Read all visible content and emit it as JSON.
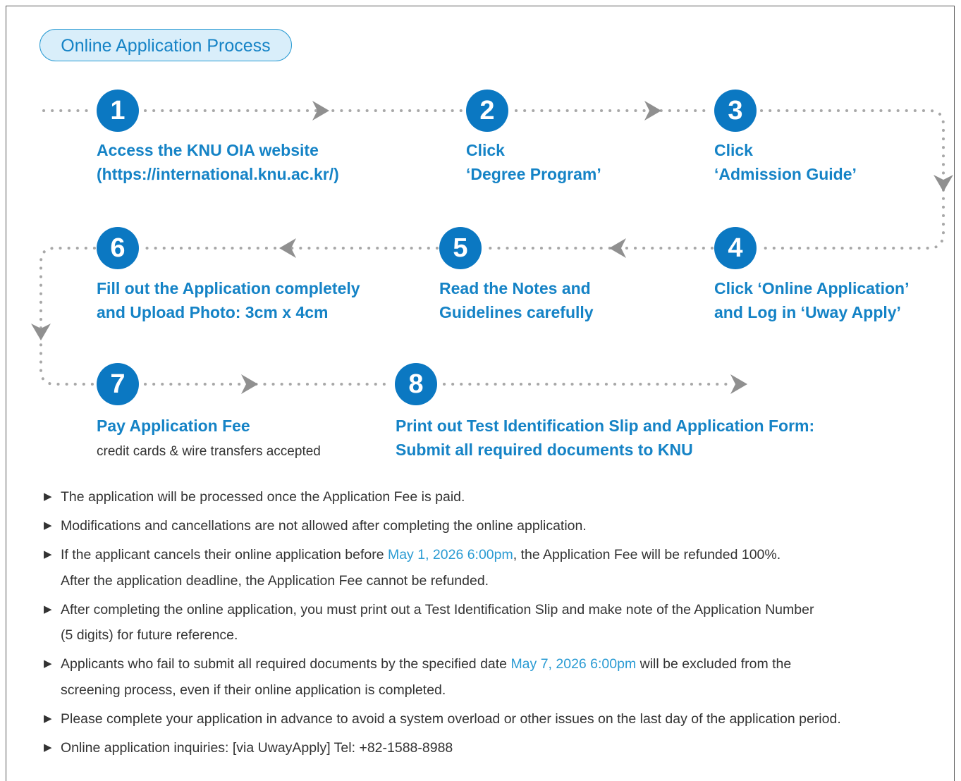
{
  "title": "Online Application Process",
  "colors": {
    "accent": "#0b78c2",
    "text_accent": "#1583c6",
    "connector": "#a8a8a8",
    "pill_bg": "#d9eefa"
  },
  "steps": [
    {
      "number": "1",
      "lines": [
        "Access the KNU OIA website",
        "(https://international.knu.ac.kr/)"
      ]
    },
    {
      "number": "2",
      "lines": [
        "Click",
        "‘Degree Program’"
      ]
    },
    {
      "number": "3",
      "lines": [
        "Click",
        "‘Admission Guide’"
      ]
    },
    {
      "number": "4",
      "lines": [
        "Click ‘Online Application’",
        "and Log in ‘Uway Apply’"
      ]
    },
    {
      "number": "5",
      "lines": [
        "Read the Notes and",
        "Guidelines carefully"
      ]
    },
    {
      "number": "6",
      "lines": [
        "Fill out the Application completely",
        "and Upload Photo: 3cm x 4cm"
      ]
    },
    {
      "number": "7",
      "lines": [
        "Pay Application Fee"
      ],
      "sub": "credit cards & wire transfers accepted"
    },
    {
      "number": "8",
      "lines": [
        "Print out Test Identification Slip and Application Form:",
        "Submit all required documents to KNU"
      ]
    }
  ],
  "notes": {
    "n1": "The application will be processed once the Application Fee is paid.",
    "n2": "Modifications and cancellations are not allowed after completing the online application.",
    "n3_a": "If the applicant cancels their online application before ",
    "n3_date": "May 1, 2026 6:00pm",
    "n3_b": ", the Application Fee will be refunded 100%.",
    "n3_c": "After the application deadline, the Application Fee cannot be refunded.",
    "n4_a": "After completing the online application, you must print out a Test Identification Slip and make note of the Application Number",
    "n4_b": "(5 digits) for future reference.",
    "n5_a": "Applicants who fail to submit all required documents by the specified date ",
    "n5_date": "May 7, 2026 6:00pm",
    "n5_b": " will be excluded from the",
    "n5_c": "screening process, even if their online application is completed.",
    "n6": "Please complete your application in advance to avoid a system overload or other issues on the last day of the application period.",
    "n7": "Online application inquiries: [via UwayApply] Tel: +82-1588-8988"
  }
}
